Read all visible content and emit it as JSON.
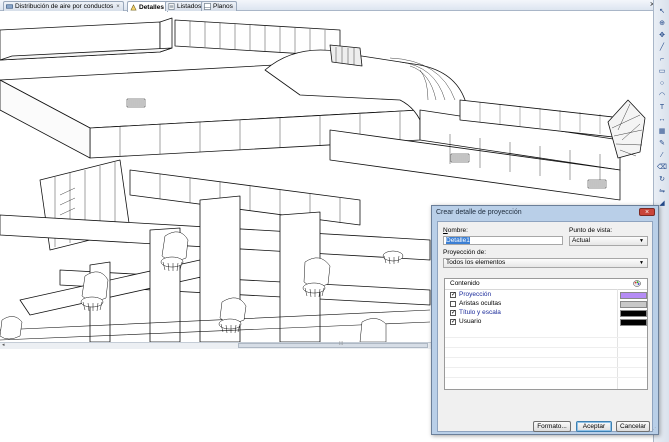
{
  "tabs": [
    {
      "label": "Distribución de aire por conductos",
      "active": false,
      "closable": true,
      "icon": "duct-icon"
    },
    {
      "label": "Detalles",
      "active": true,
      "closable": false,
      "icon": "details-icon"
    },
    {
      "label": "Listados",
      "active": false,
      "closable": false,
      "icon": "list-icon"
    },
    {
      "label": "Planos",
      "active": false,
      "closable": false,
      "icon": "plans-icon"
    }
  ],
  "window": {
    "close_glyph": "×"
  },
  "dialog": {
    "title": "Crear detalle de proyección",
    "close_glyph": "×",
    "nombre_label": "Nombre:",
    "nombre_value": "Detalle1",
    "punto_vista_label": "Punto de vista:",
    "punto_vista_value": "Actual",
    "proyeccion_label": "Proyección de:",
    "proyeccion_value": "Todos los elementos",
    "contenido_header": "Contenido",
    "items": [
      {
        "label": "Proyección",
        "checked": true,
        "color": "#b58cf5"
      },
      {
        "label": "Aristas ocultas",
        "checked": false,
        "color": "#c8c8c8"
      },
      {
        "label": "Título y escala",
        "checked": true,
        "color": "#000000"
      },
      {
        "label": "Usuario",
        "checked": true,
        "color": "#000000"
      }
    ],
    "buttons": {
      "formato": "Formato...",
      "aceptar": "Aceptar",
      "cancelar": "Cancelar"
    }
  },
  "colors": {
    "accent": "#3b7fd4",
    "link_text": "#1a2a9a",
    "dialog_frame": "#b9cfe8"
  }
}
